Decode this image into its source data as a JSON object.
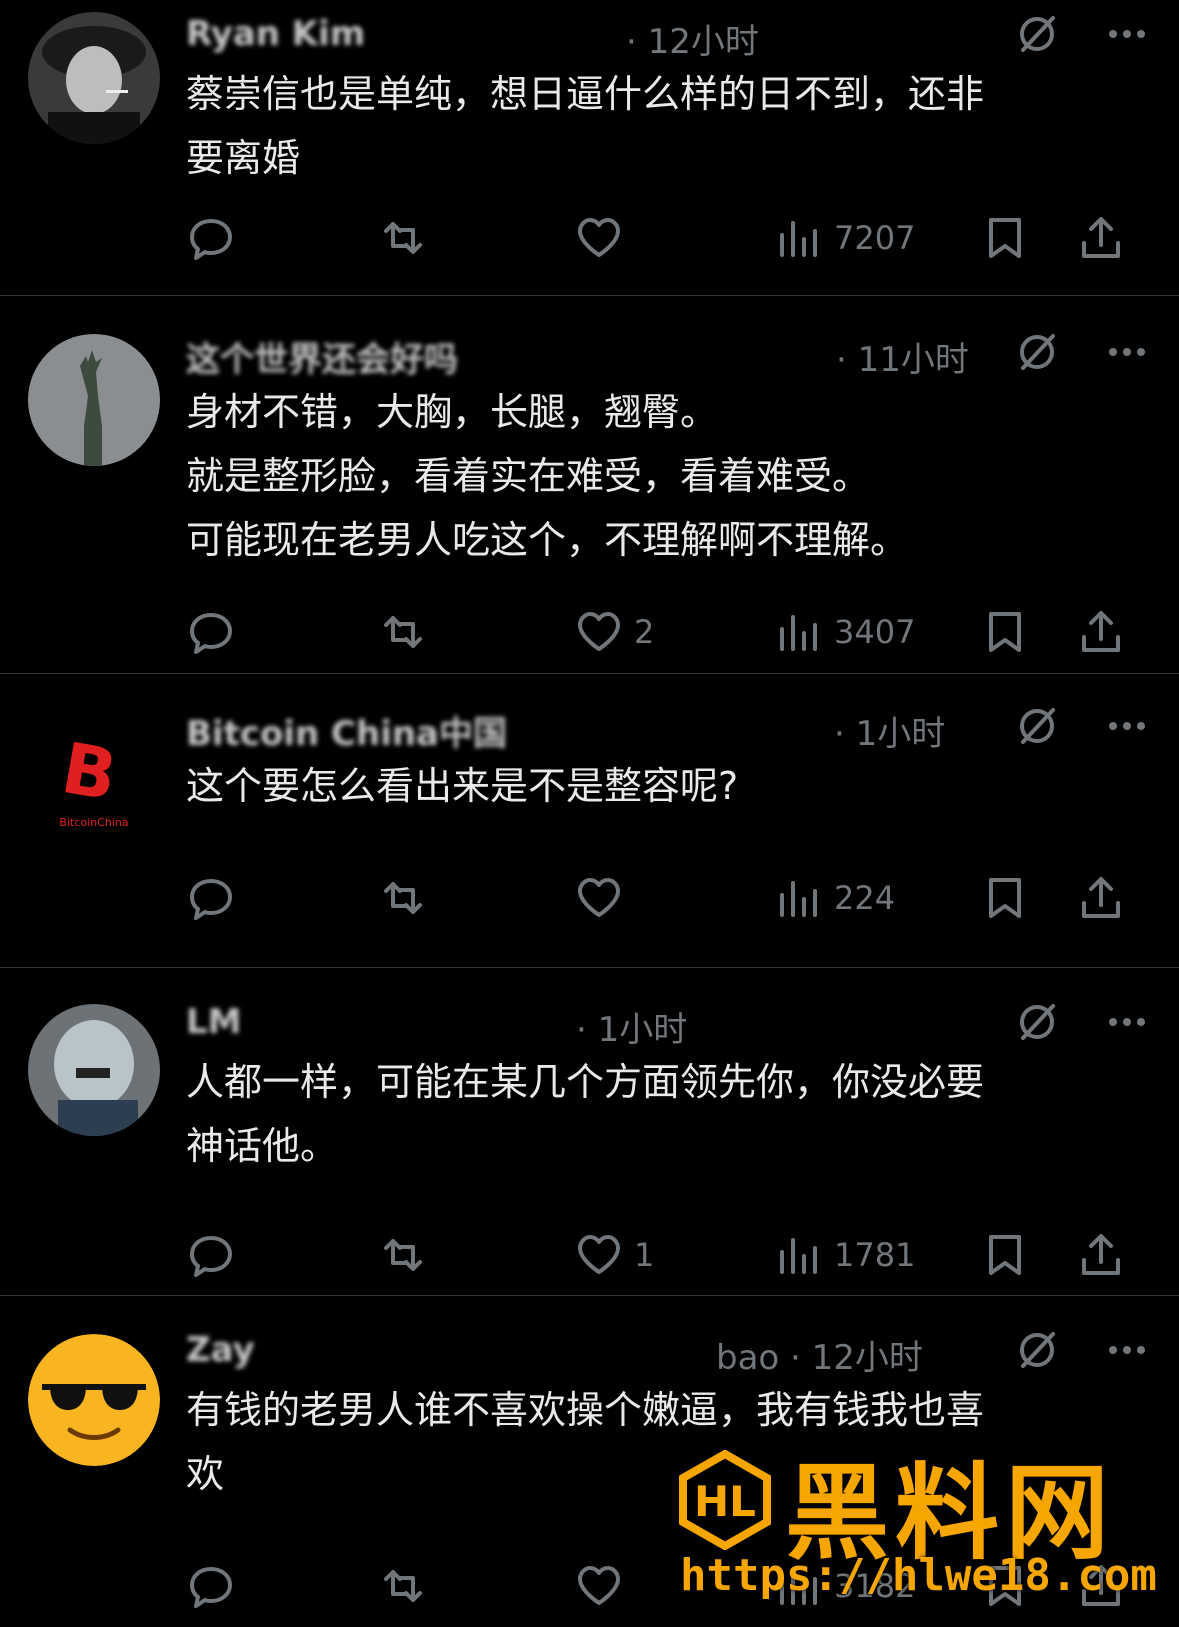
{
  "posts": [
    {
      "name": "Ryan Kim",
      "meta": "· 12小时",
      "lines": [
        "蔡崇信也是单纯，想日逼什么样的日不到，还非",
        "要离婚"
      ],
      "reply_count": "",
      "repost_count": "",
      "like_count": "",
      "view_count": "7207"
    },
    {
      "name": "这个世界还会好吗",
      "meta": "· 11小时",
      "lines": [
        "身材不错，大胸，长腿，翘臀。",
        "就是整形脸，看着实在难受，看着难受。",
        "可能现在老男人吃这个，不理解啊不理解。"
      ],
      "reply_count": "",
      "repost_count": "",
      "like_count": "2",
      "view_count": "3407"
    },
    {
      "name": "Bitcoin China中国",
      "meta": "· 1小时",
      "lines": [
        "这个要怎么看出来是不是整容呢?"
      ],
      "reply_count": "",
      "repost_count": "",
      "like_count": "",
      "view_count": "224"
    },
    {
      "name": "LM",
      "meta": "· 1小时",
      "lines": [
        "人都一样，可能在某几个方面领先你，你没必要",
        "神话他。"
      ],
      "reply_count": "",
      "repost_count": "",
      "like_count": "1",
      "view_count": "1781"
    },
    {
      "name": "Zay",
      "meta": "bao · 12小时",
      "lines": [
        "有钱的老男人谁不喜欢操个嫩逼，我有钱我也喜",
        "欢"
      ],
      "reply_count": "",
      "repost_count": "",
      "like_count": "",
      "view_count": "3182"
    }
  ],
  "avatar3_text": "BitcoinChina",
  "watermark": {
    "logo_text": "HL",
    "title": "黑料网",
    "url": "https://hlwe18.com"
  },
  "colors": {
    "background": "#000000",
    "text": "#e7e9ea",
    "muted": "#71767b",
    "divider": "#2f3336",
    "watermark": "#f7a600"
  }
}
